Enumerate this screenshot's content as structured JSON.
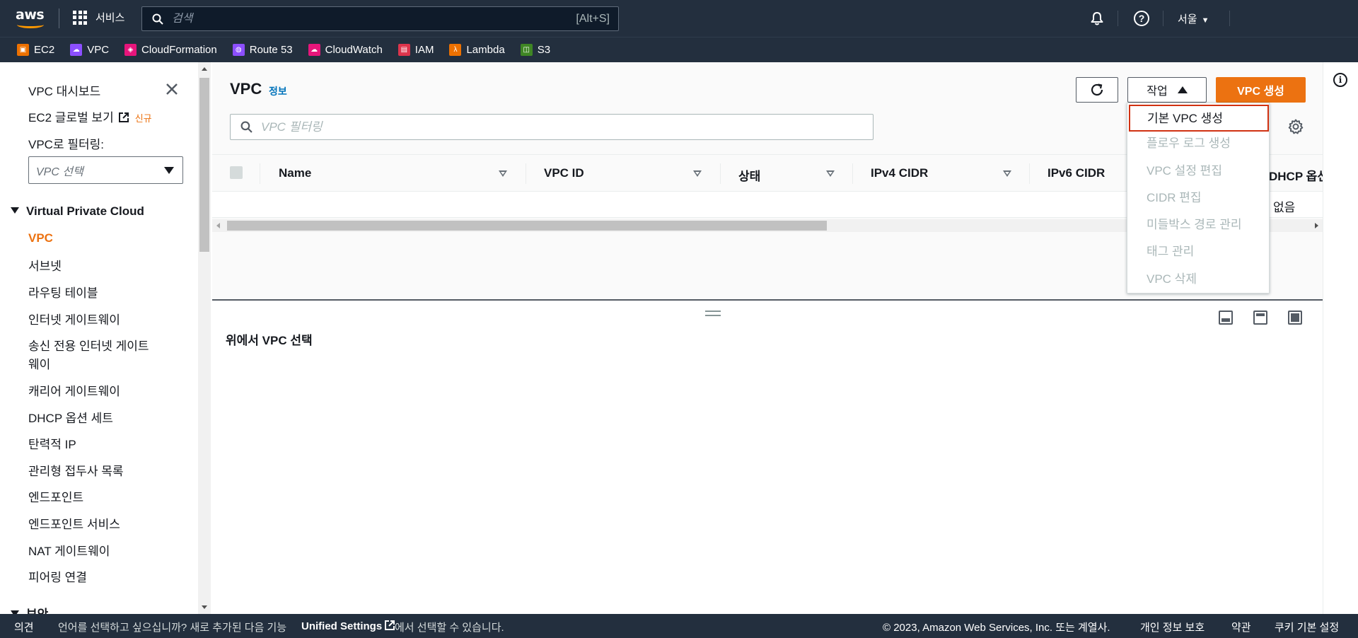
{
  "topnav": {
    "logo_text": "aws",
    "services_label": "서비스",
    "search_placeholder": "검색",
    "search_shortcut": "[Alt+S]",
    "help_glyph": "?",
    "region": "서울"
  },
  "favorites": [
    {
      "label": "EC2",
      "color": "#ed7100"
    },
    {
      "label": "VPC",
      "color": "#8c4fff"
    },
    {
      "label": "CloudFormation",
      "color": "#e7157b"
    },
    {
      "label": "Route 53",
      "color": "#8c4fff"
    },
    {
      "label": "CloudWatch",
      "color": "#e7157b"
    },
    {
      "label": "IAM",
      "color": "#dd344c"
    },
    {
      "label": "Lambda",
      "color": "#ed7100"
    },
    {
      "label": "S3",
      "color": "#3f8624"
    }
  ],
  "sidebar": {
    "dashboard": "VPC 대시보드",
    "ec2_global": "EC2 글로벌 보기",
    "new_badge": "신규",
    "filter_label": "VPC로 필터링:",
    "vpc_select_placeholder": "VPC 선택",
    "section_vpc": "Virtual Private Cloud",
    "items": [
      "VPC",
      "서브넷",
      "라우팅 테이블",
      "인터넷 게이트웨이",
      "송신 전용 인터넷 게이트",
      "웨이",
      "캐리어 게이트웨이",
      "DHCP 옵션 세트",
      "탄력적 IP",
      "관리형 접두사 목록",
      "엔드포인트",
      "엔드포인트 서비스",
      "NAT 게이트웨이",
      "피어링 연결"
    ],
    "section_security": "보안"
  },
  "main": {
    "title": "VPC",
    "info_link": "정보",
    "actions_label": "작업",
    "create_label": "VPC 생성",
    "filter_placeholder": "VPC 필터링",
    "columns": [
      "Name",
      "VPC ID",
      "상태",
      "IPv4 CIDR",
      "IPv6 CIDR",
      "DHCP 옵션"
    ],
    "row_partial": "없음",
    "detail_placeholder": "위에서 VPC 선택",
    "info_glyph": "i"
  },
  "actions_menu": [
    {
      "label": "기본 VPC 생성",
      "enabled": true
    },
    {
      "label": "플로우 로그 생성",
      "enabled": false
    },
    {
      "label": "VPC 설정 편집",
      "enabled": false
    },
    {
      "label": "CIDR 편집",
      "enabled": false
    },
    {
      "label": "미들박스 경로 관리",
      "enabled": false
    },
    {
      "label": "태그 관리",
      "enabled": false
    },
    {
      "label": "VPC 삭제",
      "enabled": false
    }
  ],
  "footer": {
    "feedback": "의견",
    "lang_msg": "언어를 선택하고 싶으십니까? 새로 추가된 다음 기능",
    "unified": "Unified Settings",
    "lang_msg2": "에서 선택할 수 있습니다.",
    "copyright": "© 2023, Amazon Web Services, Inc. 또는 계열사.",
    "privacy": "개인 정보 보호",
    "terms": "약관",
    "cookies": "쿠키 기본 설정"
  },
  "colors": {
    "accent": "#ec7211",
    "nav_bg": "#232f3e",
    "link": "#0073bb",
    "focus": "#d13212"
  }
}
